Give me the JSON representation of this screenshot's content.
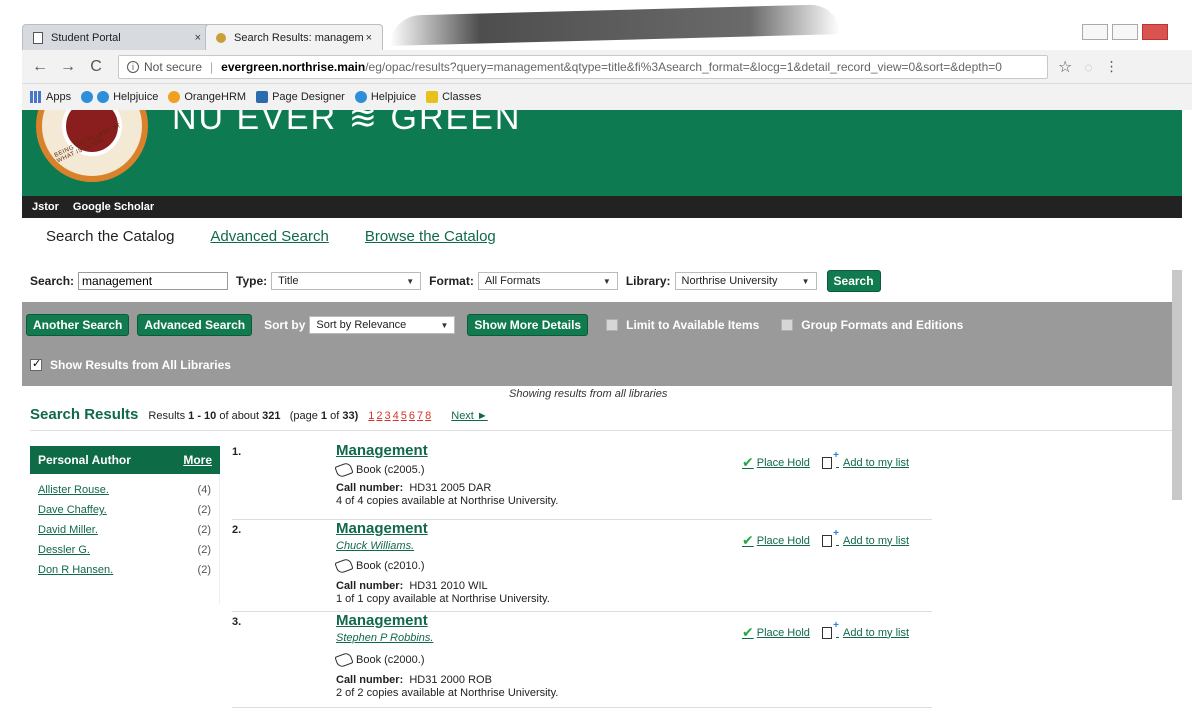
{
  "browser": {
    "tabs": [
      {
        "label": "Student Portal",
        "close": "×"
      },
      {
        "label": "Search Results: managem",
        "close": "×"
      }
    ],
    "address": {
      "security": "Not secure",
      "host": "evergreen.northrise.main",
      "path": "/eg/opac/results?query=management&qtype=title&fi%3Asearch_format=&locg=1&detail_record_view=0&sort=&depth=0"
    },
    "bookmarks": [
      "Apps",
      "Helpjuice",
      "OrangeHRM",
      "Page Designer",
      "Helpjuice",
      "Classes"
    ]
  },
  "site": {
    "brand": "NU EVER ≋ GREEN",
    "logo_motto": "BEING EXCELLENT AT WHAT IS GOOD",
    "quick_links": [
      "Jstor",
      "Google Scholar"
    ]
  },
  "catalog_tabs": {
    "current": "Search the Catalog",
    "advanced": "Advanced Search",
    "browse": "Browse the Catalog"
  },
  "search": {
    "search_label": "Search:",
    "query": "management",
    "type_label": "Type:",
    "type_value": "Title",
    "format_label": "Format:",
    "format_value": "All Formats",
    "library_label": "Library:",
    "library_value": "Northrise University",
    "search_button": "Search"
  },
  "toolbar": {
    "another_search": "Another Search",
    "advanced_search": "Advanced Search",
    "sort_label": "Sort by",
    "sort_value": "Sort by Relevance",
    "show_more": "Show More Details",
    "limit_available": "Limit to Available Items",
    "group_formats": "Group Formats and Editions",
    "show_all_libraries": "Show Results from All Libraries"
  },
  "results_header": {
    "showing": "Showing results from all libraries",
    "title": "Search Results",
    "summary_prefix": "Results",
    "range": "1 - 10",
    "of_about": "of about",
    "total": "321",
    "page_text": "(page",
    "page": "1",
    "of": "of",
    "pages_total": "33)",
    "page_links": [
      "1",
      "2",
      "3",
      "4",
      "5",
      "6",
      "7",
      "8"
    ],
    "next": "Next ►"
  },
  "facet": {
    "title": "Personal Author",
    "more": "More",
    "items": [
      {
        "name": "Allister Rouse.",
        "count": "(4)"
      },
      {
        "name": "Dave Chaffey.",
        "count": "(2)"
      },
      {
        "name": "David Miller.",
        "count": "(2)"
      },
      {
        "name": "Dessler G.",
        "count": "(2)"
      },
      {
        "name": "Don R Hansen.",
        "count": "(2)"
      }
    ]
  },
  "results": [
    {
      "num": "1.",
      "title": "Management",
      "author": "",
      "format": "Book (c2005.)",
      "call_label": "Call number:",
      "call_number": "HD31 2005 DAR",
      "copies": "4 of 4 copies available at Northrise University."
    },
    {
      "num": "2.",
      "title": "Management",
      "author": "Chuck Williams.",
      "format": "Book (c2010.)",
      "call_label": "Call number:",
      "call_number": "HD31 2010 WIL",
      "copies": "1 of 1 copy available at Northrise University."
    },
    {
      "num": "3.",
      "title": "Management",
      "author": "Stephen P Robbins.",
      "format": "Book (c2000.)",
      "call_label": "Call number:",
      "call_number": "HD31 2000 ROB",
      "copies": "2 of 2 copies available at Northrise University."
    }
  ],
  "actions": {
    "place_hold": "Place Hold",
    "add_to_list": "Add to my list"
  },
  "icons": {
    "hold": "check-icon",
    "list": "add-to-list-icon",
    "format": "book-icon"
  },
  "colors": {
    "brand_green": "#0d7a52",
    "link_green": "#11694a",
    "page_link_red": "#d0382b",
    "toolbar_gray": "#9a9a9a"
  }
}
